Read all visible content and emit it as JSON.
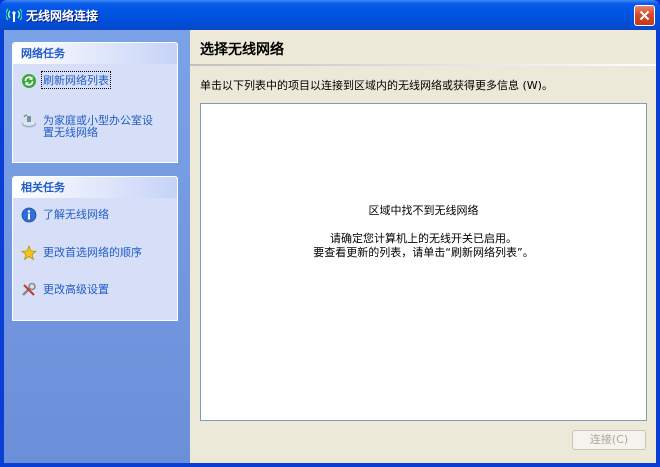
{
  "window": {
    "title": "无线网络连接",
    "close_symbol": "✕"
  },
  "sidebar": {
    "network_tasks": {
      "heading": "网络任务",
      "items": [
        {
          "label": "刷新网络列表",
          "icon": "refresh-icon"
        },
        {
          "label_line1": "为家庭或小型办公室设",
          "label_line2": "置无线网络",
          "icon": "home-network-icon"
        }
      ]
    },
    "related_tasks": {
      "heading": "相关任务",
      "items": [
        {
          "label": "了解无线网络",
          "icon": "info-icon"
        },
        {
          "label": "更改首选网络的顺序",
          "icon": "star-icon"
        },
        {
          "label": "更改高级设置",
          "icon": "tools-icon"
        }
      ]
    }
  },
  "main": {
    "title": "选择无线网络",
    "instruction": "单击以下列表中的项目以连接到区域内的无线网络或获得更多信息 (W)。",
    "empty": {
      "line1": "区域中找不到无线网络",
      "line2": "请确定您计算机上的无线开关已启用。",
      "line3": "要查看更新的列表，请单击“刷新网络列表”。"
    },
    "connect_button": "连接(C)"
  },
  "colors": {
    "titlebar": "#0054e3",
    "sidebar": "#7ba2e7",
    "task_link": "#215dc6",
    "client_bg": "#ece9d8"
  }
}
